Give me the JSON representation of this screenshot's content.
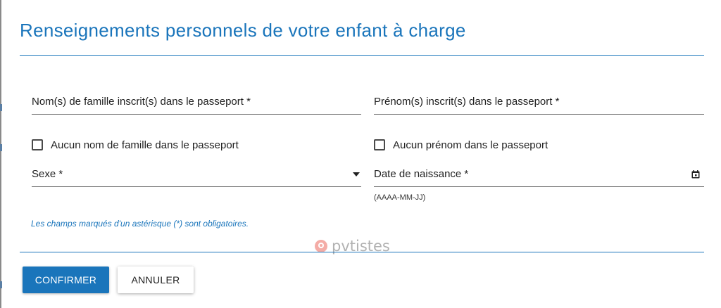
{
  "dialog": {
    "title": "Renseignements personnels de votre enfant à charge",
    "accent_color": "#1a75bb"
  },
  "fields": {
    "surname": {
      "label": "Nom(s) de famille inscrit(s) dans le passeport *",
      "value": ""
    },
    "given_names": {
      "label": "Prénom(s) inscrit(s) dans le passeport *",
      "value": ""
    },
    "sex": {
      "label": "Sexe *",
      "value": ""
    },
    "birth_date": {
      "label": "Date de naissance *",
      "hint": "(AAAA-MM-JJ)",
      "value": ""
    }
  },
  "checkboxes": {
    "no_surname": {
      "label": "Aucun nom de famille dans le passeport",
      "checked": false
    },
    "no_given_name": {
      "label": "Aucun prénom dans le passeport",
      "checked": false
    }
  },
  "required_note": "Les champs marqués d'un astérisque (*) sont obligatoires.",
  "watermark": {
    "text": "pvtistes"
  },
  "buttons": {
    "confirm": "CONFIRMER",
    "cancel": "ANNULER"
  },
  "icons": {
    "dropdown": "chevron-down-icon",
    "calendar": "calendar-icon",
    "watermark_logo": "pin-logo-icon"
  }
}
